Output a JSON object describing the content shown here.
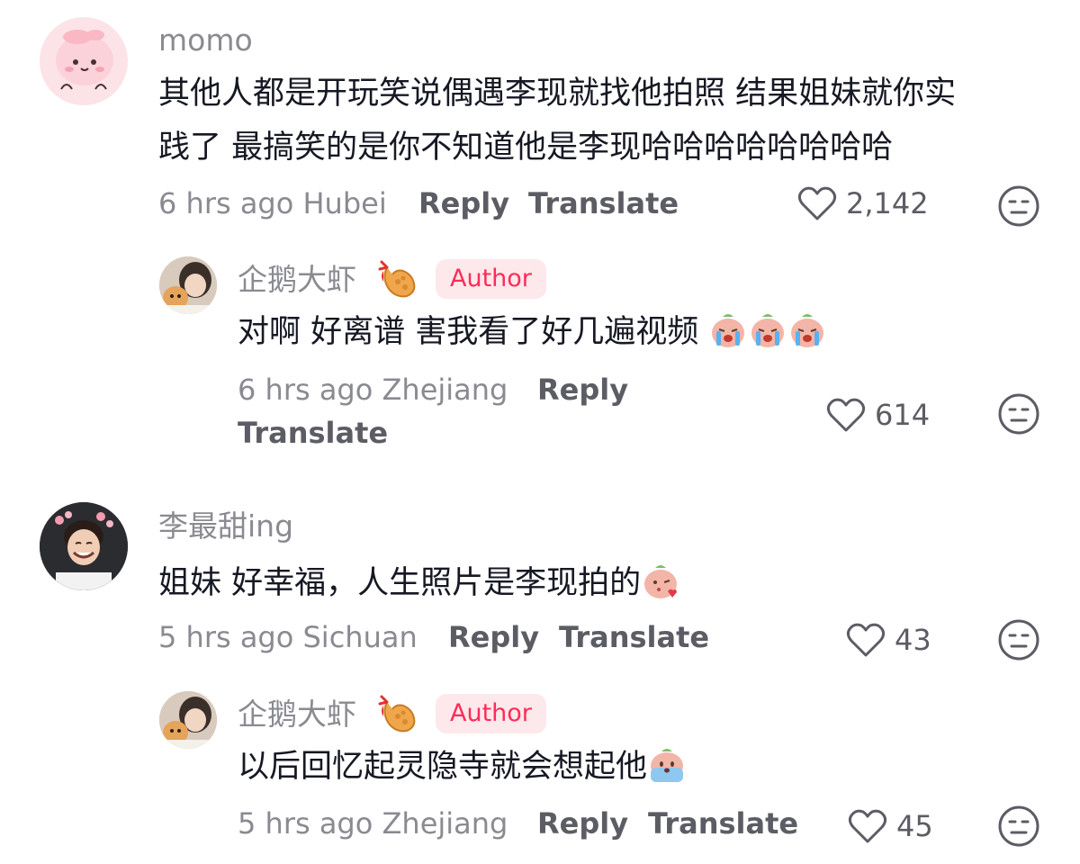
{
  "comments": [
    {
      "username": "momo",
      "text_line1": "其他人都是开玩笑说偶遇李现就找他拍照 结果姐妹就你实",
      "text_line2": "践了 最搞笑的是你不知道他是李现哈哈哈哈哈哈哈哈",
      "time": "6 hrs ago",
      "location": "Hubei",
      "reply_label": "Reply",
      "translate_label": "Translate",
      "likes": "2,142",
      "reply": {
        "username": "企鹅大虾",
        "badge": "Author",
        "text": "对啊 好离谱 害我看了好几遍视频",
        "time": "6 hrs ago",
        "location": "Zhejiang",
        "reply_label": "Reply",
        "translate_label": "Translate",
        "likes": "614"
      }
    },
    {
      "username": "李最甜ing",
      "text": "姐妹 好幸福，人生照片是李现拍的",
      "time": "5 hrs ago",
      "location": "Sichuan",
      "reply_label": "Reply",
      "translate_label": "Translate",
      "likes": "43",
      "reply": {
        "username": "企鹅大虾",
        "badge": "Author",
        "text": "以后回忆起灵隐寺就会想起他",
        "time": "5 hrs ago",
        "location": "Zhejiang",
        "reply_label": "Reply",
        "translate_label": "Translate",
        "likes": "45"
      }
    }
  ],
  "icons": {
    "like": "heart-outline-icon",
    "dislike": "neutral-face-icon",
    "shrimp": "fried-shrimp-icon"
  },
  "colors": {
    "author_badge_bg": "#fde8ec",
    "author_badge_text": "#fe2c55",
    "meta_gray": "#8a8b91",
    "action_gray": "#5c5d64"
  }
}
